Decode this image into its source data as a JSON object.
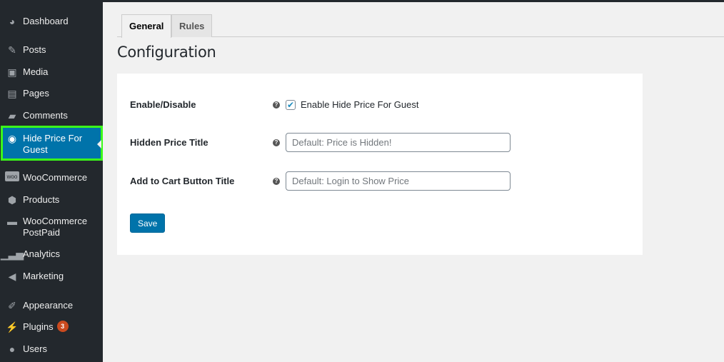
{
  "sidebar": {
    "items": [
      {
        "label": "Dashboard",
        "icon": "dashboard-icon"
      },
      {
        "label": "Posts",
        "icon": "pin-icon"
      },
      {
        "label": "Media",
        "icon": "media-icon"
      },
      {
        "label": "Pages",
        "icon": "pages-icon"
      },
      {
        "label": "Comments",
        "icon": "comment-icon"
      },
      {
        "label": "Hide Price For Guest",
        "icon": "eye-icon"
      },
      {
        "label": "WooCommerce",
        "icon": "woo-icon"
      },
      {
        "label": "Products",
        "icon": "box-icon"
      },
      {
        "label": "WooCommerce PostPaid",
        "icon": "postpaid-icon"
      },
      {
        "label": "Analytics",
        "icon": "bar-chart-icon"
      },
      {
        "label": "Marketing",
        "icon": "megaphone-icon"
      },
      {
        "label": "Appearance",
        "icon": "brush-icon"
      },
      {
        "label": "Plugins",
        "icon": "plug-icon",
        "badge": "3"
      },
      {
        "label": "Users",
        "icon": "user-icon"
      }
    ]
  },
  "tabs": [
    {
      "label": "General"
    },
    {
      "label": "Rules"
    }
  ],
  "page_title": "Configuration",
  "form": {
    "enable_label": "Enable/Disable",
    "enable_checkbox_label": "Enable Hide Price For Guest",
    "enable_checked": true,
    "hidden_title_label": "Hidden Price Title",
    "hidden_title_placeholder": "Default: Price is Hidden!",
    "cart_title_label": "Add to Cart Button Title",
    "cart_title_placeholder": "Default: Login to Show Price",
    "help_glyph": "?",
    "check_glyph": "✔",
    "save_label": "Save"
  }
}
